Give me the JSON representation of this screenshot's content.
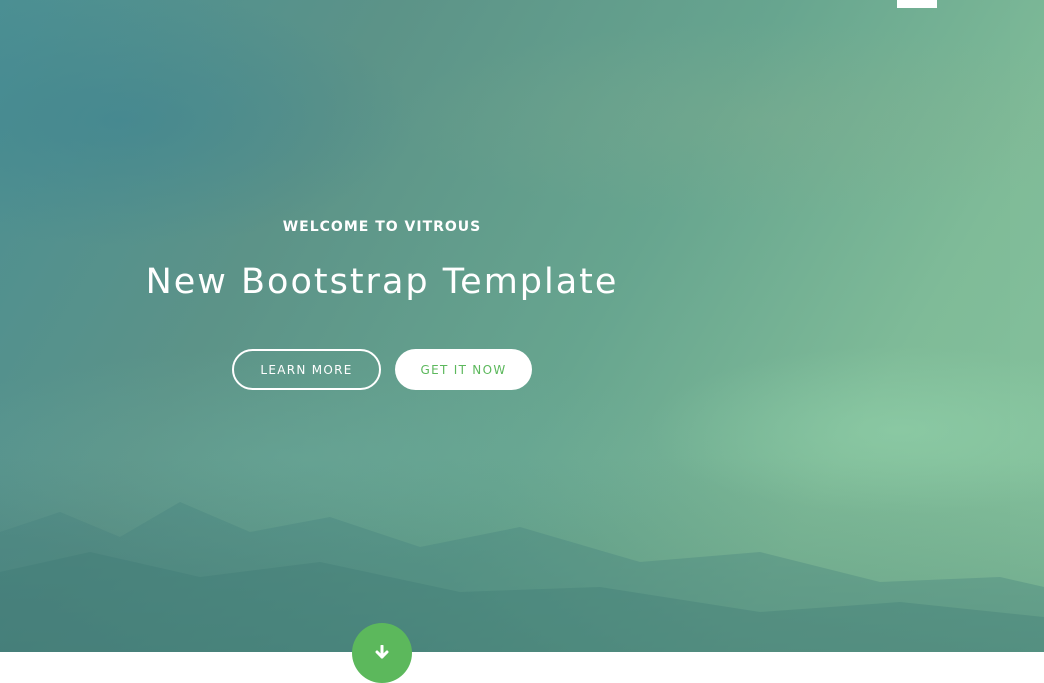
{
  "hero": {
    "welcome": "WELCOME TO VITROUS",
    "headline": "New Bootstrap Template",
    "buttons": {
      "learn_more": "LEARN MORE",
      "get_it_now": "GET IT NOW"
    },
    "scroll_icon": "arrow-down-icon"
  },
  "colors": {
    "accent": "#5cb85c",
    "text_light": "#ffffff",
    "hero_base": "#5f9a8c"
  }
}
